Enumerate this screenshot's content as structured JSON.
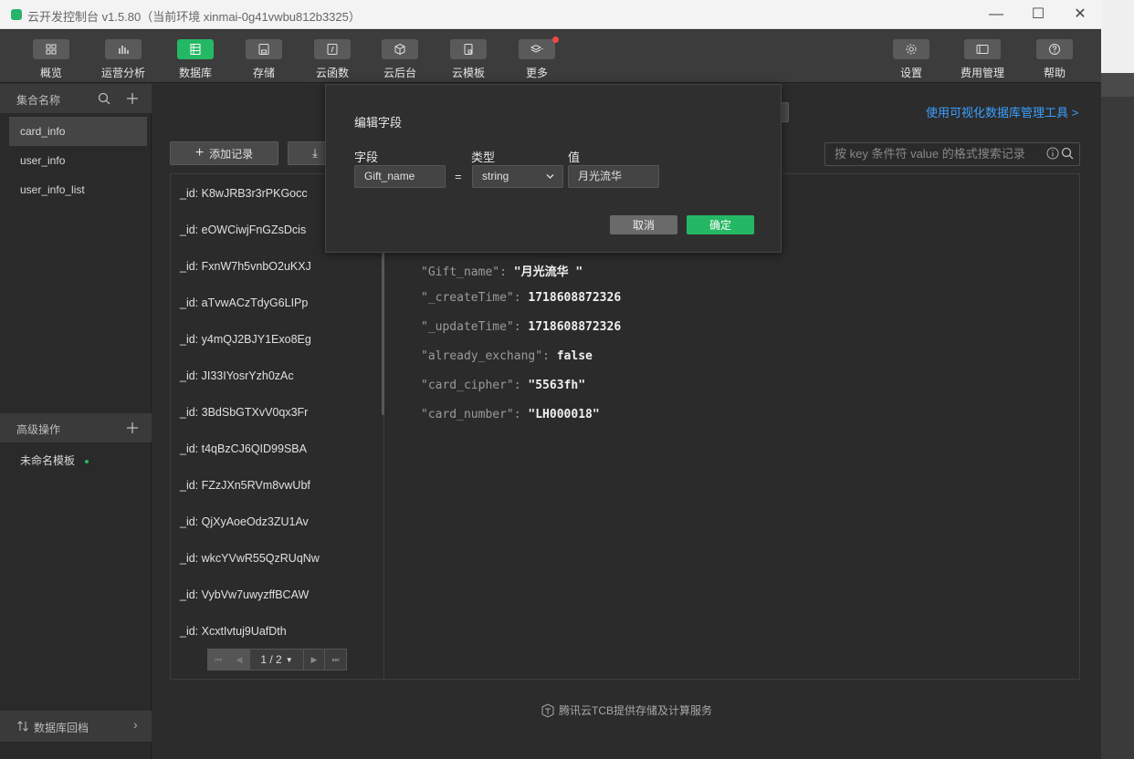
{
  "window": {
    "title": "云开发控制台 v1.5.80（当前环境 xinmai-0g41vwbu812b3325）",
    "controls": {
      "minimize": "—",
      "maximize": "☐",
      "close": "✕"
    }
  },
  "toolbar": {
    "items": [
      {
        "label": "概览",
        "icon": "grid-icon"
      },
      {
        "label": "运营分析",
        "icon": "bar-chart-icon"
      },
      {
        "label": "数据库",
        "icon": "database-icon",
        "active": true
      },
      {
        "label": "存储",
        "icon": "storage-icon"
      },
      {
        "label": "云函数",
        "icon": "function-icon"
      },
      {
        "label": "云后台",
        "icon": "cube-icon"
      },
      {
        "label": "云模板",
        "icon": "template-icon"
      },
      {
        "label": "更多",
        "icon": "layers-icon"
      }
    ],
    "right_items": [
      {
        "label": "设置",
        "icon": "gear-icon"
      },
      {
        "label": "费用管理",
        "icon": "billing-icon"
      },
      {
        "label": "帮助",
        "icon": "help-icon"
      }
    ]
  },
  "sidebar": {
    "collections_header": "集合名称",
    "collections": [
      "card_info",
      "user_info",
      "user_info_list"
    ],
    "advanced_header": "高级操作",
    "templates": [
      "未命名模板"
    ],
    "backup_label": "数据库回档"
  },
  "main": {
    "add_record": "添加记录",
    "visual_tool_link": "使用可视化数据库管理工具 >",
    "search_placeholder": "按 key 条件符 value 的格式搜索记录",
    "records": [
      "_id: K8wJRB3r3rPKGocc",
      "_id: eOWCiwjFnGZsDcis",
      "_id: FxnW7h5vnbO2uKXJ",
      "_id: aTvwACzTdyG6LIPp",
      "_id: y4mQJ2BJY1Exo8Eg",
      "_id: JI33IYosrYzh0zAc",
      "_id: 3BdSbGTXvV0qx3Fr",
      "_id: t4qBzCJ6QID99SBA",
      "_id: FZzJXn5RVm8vwUbf",
      "_id: QjXyAoeOdz3ZU1Av",
      "_id: wkcYVwR55QzRUqNw",
      "_id: VybVw7uwyzffBCAW",
      "_id: XcxtIvtuj9UafDth"
    ],
    "pager": "1 / 2",
    "fields": [
      {
        "key": "\"Gift_name\"",
        "value": "\"月光流华 \""
      },
      {
        "key": "\"_createTime\"",
        "value": "1718608872326"
      },
      {
        "key": "\"_updateTime\"",
        "value": "1718608872326"
      },
      {
        "key": "\"already_exchang\"",
        "value": "false"
      },
      {
        "key": "\"card_cipher\"",
        "value": "\"5563fh\""
      },
      {
        "key": "\"card_number\"",
        "value": "\"LH000018\""
      }
    ],
    "footer": "腾讯云TCB提供存储及计算服务"
  },
  "dialog": {
    "title": "编辑字段",
    "field_label": "字段",
    "type_label": "类型",
    "value_label": "值",
    "field_value": "Gift_name",
    "equals": "=",
    "type_value": "string",
    "value_value": "月光流华",
    "cancel": "取消",
    "confirm": "确定"
  },
  "colors": {
    "accent": "#25b864",
    "link": "#3aa0ff",
    "badge": "#f04848"
  }
}
